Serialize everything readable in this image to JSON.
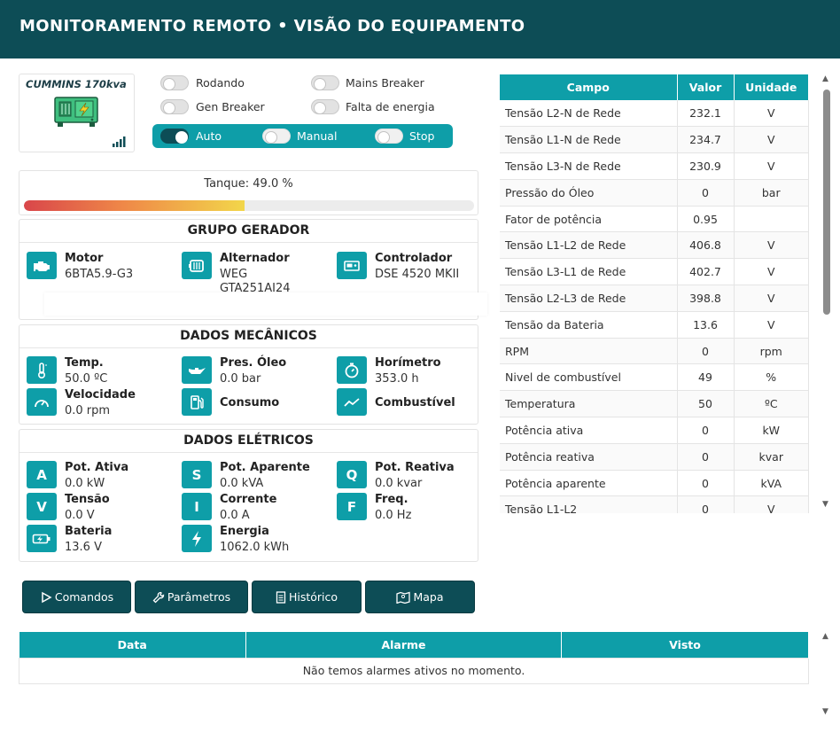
{
  "header": {
    "title": "MONITORAMENTO REMOTO • VISÃO DO EQUIPAMENTO"
  },
  "equipment": {
    "name": "CUMMINS 170kva",
    "icon": "generator-icon",
    "signal_icon": "signal-bars-icon"
  },
  "status_toggles": [
    {
      "label": "Rodando",
      "on": false
    },
    {
      "label": "Mains Breaker",
      "on": false
    },
    {
      "label": "Gen Breaker",
      "on": false
    },
    {
      "label": "Falta de energia",
      "on": false
    }
  ],
  "mode": {
    "options": [
      {
        "label": "Auto",
        "on": true
      },
      {
        "label": "Manual",
        "on": false
      },
      {
        "label": "Stop",
        "on": false
      }
    ]
  },
  "tank": {
    "label": "Tanque: 49.0 %",
    "level_percent": 49.0
  },
  "grupo_gerador": {
    "title": "GRUPO GERADOR",
    "items": [
      {
        "label": "Motor",
        "value": "6BTA5.9-G3",
        "icon": "engine-icon"
      },
      {
        "label": "Alternador",
        "value": "WEG",
        "value2": "GTA251AI24",
        "icon": "alternator-icon"
      },
      {
        "label": "Controlador",
        "value": "DSE 4520 MKII",
        "icon": "controller-icon"
      }
    ]
  },
  "dados_mecanicos": {
    "title": "DADOS MECÂNICOS",
    "items": [
      {
        "label": "Temp.",
        "value": "50.0 ºC",
        "icon": "thermometer-icon"
      },
      {
        "label": "Pres. Óleo",
        "value": "0.0 bar",
        "icon": "oil-can-icon"
      },
      {
        "label": "Horímetro",
        "value": "353.0 h",
        "icon": "stopwatch-icon"
      },
      {
        "label": "Velocidade",
        "value": "0.0 rpm",
        "icon": "speedometer-icon"
      },
      {
        "label": "Consumo",
        "value": "",
        "icon": "fuel-pump-icon"
      },
      {
        "label": "Combustível",
        "value": "",
        "icon": "line-chart-icon"
      }
    ]
  },
  "dados_eletricos": {
    "title": "DADOS ELÉTRICOS",
    "items": [
      {
        "label": "Pot. Ativa",
        "value": "0.0 kW",
        "icon_text": "A"
      },
      {
        "label": "Pot. Aparente",
        "value": "0.0 kVA",
        "icon_text": "S"
      },
      {
        "label": "Pot. Reativa",
        "value": "0.0 kvar",
        "icon_text": "Q"
      },
      {
        "label": "Tensão",
        "value": "0.0 V",
        "icon_text": "V"
      },
      {
        "label": "Corrente",
        "value": "0.0 A",
        "icon_text": "I"
      },
      {
        "label": "Freq.",
        "value": "0.0 Hz",
        "icon_text": "F"
      },
      {
        "label": "Bateria",
        "value": "13.6 V",
        "icon": "battery-charging-icon"
      },
      {
        "label": "Energia",
        "value": "1062.0 kWh",
        "icon": "lightning-icon"
      }
    ]
  },
  "buttons": [
    {
      "label": "Comandos",
      "icon": "play-icon"
    },
    {
      "label": "Parâmetros",
      "icon": "wrench-icon"
    },
    {
      "label": "Histórico",
      "icon": "document-icon"
    },
    {
      "label": "Mapa",
      "icon": "map-icon"
    }
  ],
  "readings": {
    "headers": [
      "Campo",
      "Valor",
      "Unidade"
    ],
    "rows": [
      [
        "Tensão L2-N de Rede",
        "232.1",
        "V"
      ],
      [
        "Tensão L1-N de Rede",
        "234.7",
        "V"
      ],
      [
        "Tensão L3-N de Rede",
        "230.9",
        "V"
      ],
      [
        "Pressão do Óleo",
        "0",
        "bar"
      ],
      [
        "Fator de potência",
        "0.95",
        ""
      ],
      [
        "Tensão L1-L2 de Rede",
        "406.8",
        "V"
      ],
      [
        "Tensão L3-L1 de Rede",
        "402.7",
        "V"
      ],
      [
        "Tensão L2-L3 de Rede",
        "398.8",
        "V"
      ],
      [
        "Tensão da Bateria",
        "13.6",
        "V"
      ],
      [
        "RPM",
        "0",
        "rpm"
      ],
      [
        "Nivel de combustível",
        "49",
        "%"
      ],
      [
        "Temperatura",
        "50",
        "ºC"
      ],
      [
        "Potência ativa",
        "0",
        "kW"
      ],
      [
        "Potência reativa",
        "0",
        "kvar"
      ],
      [
        "Potência aparente",
        "0",
        "kVA"
      ],
      [
        "Tensão L1-L2",
        "0",
        "V"
      ]
    ]
  },
  "alarms": {
    "headers": [
      "Data",
      "Alarme",
      "Visto"
    ],
    "empty_message": "Não temos alarmes ativos no momento."
  }
}
